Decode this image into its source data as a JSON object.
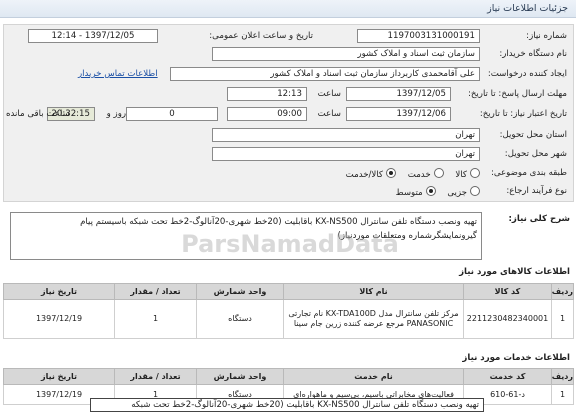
{
  "header": {
    "title": "جزئیات اطلاعات نیاز"
  },
  "form": {
    "need_number_label": "شماره نیاز:",
    "need_number": "1197003131000191",
    "announce_label": "تاریخ و ساعت اعلان عمومی:",
    "announce_value": "1397/12/05 - 12:14",
    "buyer_label": "نام دستگاه خریدار:",
    "buyer": "سازمان ثبت اسناد و املاک کشور",
    "creator_label": "ایجاد کننده درخواست:",
    "creator": "علی آقامحمدی کاربرداز سازمان ثبت اسناد و املاک کشور",
    "contact_link": "اطلاعات تماس خریدار",
    "reply_deadline_label": "مهلت ارسال پاسخ: تا تاریخ:",
    "reply_date": "1397/12/05",
    "time_label": "ساعت",
    "reply_time": "12:13",
    "validity_label": "تاریخ اعتبار نیاز: تا تاریخ:",
    "validity_date": "1397/12/06",
    "validity_time": "09:00",
    "days_value": "0",
    "days_label": "روز و",
    "remaining_time": "20:32:15",
    "remaining_label": "ساعت باقی مانده",
    "province_label": "استان محل تحویل:",
    "province": "تهران",
    "city_label": "شهر محل تحویل:",
    "city": "تهران",
    "category_label": "طبقه بندی موضوعی:",
    "category_options": [
      "کالا",
      "خدمت",
      "کالا/خدمت"
    ],
    "process_label": "نوع فرآیند ارجاع:",
    "process_options": [
      "جزیی",
      "متوسط"
    ]
  },
  "need_summary": {
    "label": "شرح کلی نیاز:",
    "text": "تهیه ونصب دستگاه تلفن سانترال KX-NS500 باقابلیت (20خط شهری-20آنالوگ-2خط تحت شبکه باسیستم پیام گیرونمایشگرشماره ومتعلقات موردنیاز)"
  },
  "goods": {
    "title": "اطلاعات کالاهای مورد نیاز",
    "headers": [
      "ردیف",
      "کد کالا",
      "نام کالا",
      "واحد شمارش",
      "تعداد / مقدار",
      "تاریخ نیاز"
    ],
    "rows": [
      [
        "1",
        "2211230482340001",
        "مرکز تلفن سانترال مدل KX-TDA100D نام تجارتی PANASONIC مرجع عرضه کننده زرین جام سینا",
        "دستگاه",
        "1",
        "1397/12/19"
      ]
    ]
  },
  "services": {
    "title": "اطلاعات خدمات مورد نیاز",
    "headers": [
      "ردیف",
      "کد خدمت",
      "نام خدمت",
      "واحد شمارش",
      "تعداد / مقدار",
      "تاریخ نیاز"
    ],
    "rows": [
      [
        "1",
        "د-61-610",
        "فعالیت‌های مخابراتی باسیم، بی‌سیم و ماهواره‌ای",
        "دستگاه",
        "1",
        "1397/12/19"
      ]
    ]
  },
  "watermark": "ParsNamadData",
  "bottom_text": "تهیه ونصب دستگاه تلفن سانترال KX-NS500 باقابلیت (20خط شهری-20آنالوگ-2خط تحت شبکه"
}
